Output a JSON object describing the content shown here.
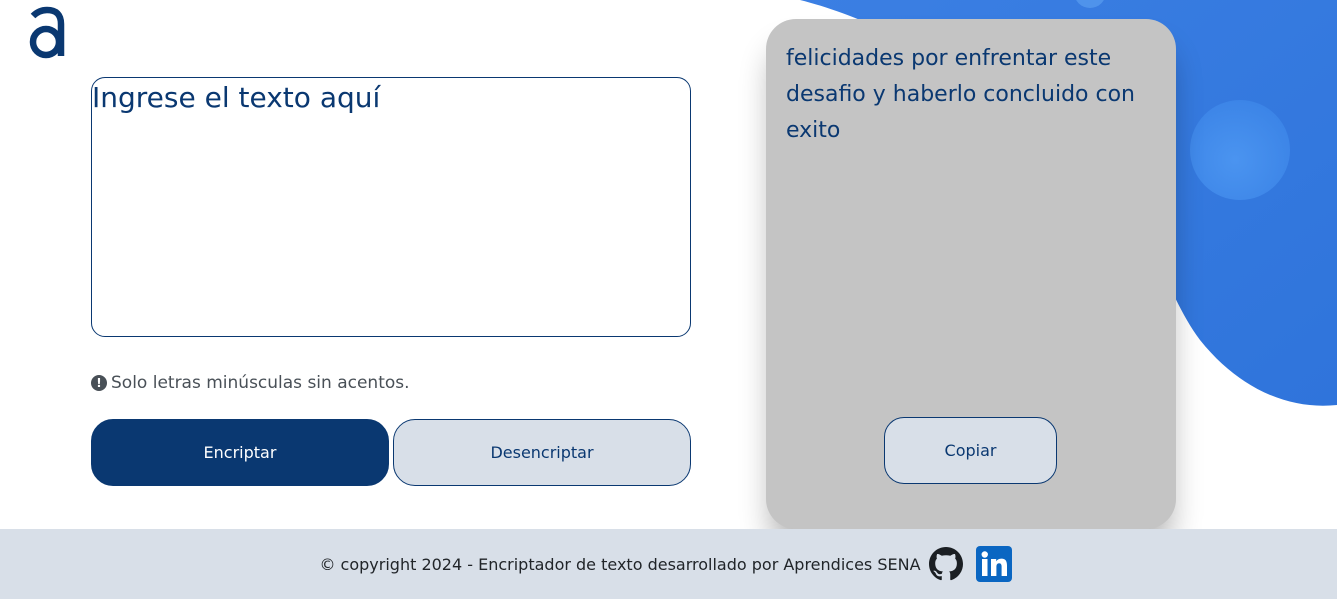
{
  "logo": {
    "icon": "alura-logo-icon",
    "letter": "a"
  },
  "encryptor": {
    "input_placeholder": "Ingrese el texto aquí",
    "input_value": "",
    "hint_icon": "!",
    "hint_text": "Solo letras minúsculas sin acentos.",
    "encrypt_label": "Encriptar",
    "decrypt_label": "Desencriptar"
  },
  "output": {
    "text": "felicidades por enfrentar este desafio y haberlo concluido con exito",
    "copy_label": "Copiar"
  },
  "footer": {
    "text": "© copyright 2024 - Encriptador de texto desarrollado por Aprendices SENA",
    "icons": [
      "github-icon",
      "linkedin-icon"
    ]
  },
  "colors": {
    "primary": "#0a3871",
    "secondary": "#d8dfe8",
    "card": "#c4c4c4",
    "blob": "#4a8fe7"
  }
}
